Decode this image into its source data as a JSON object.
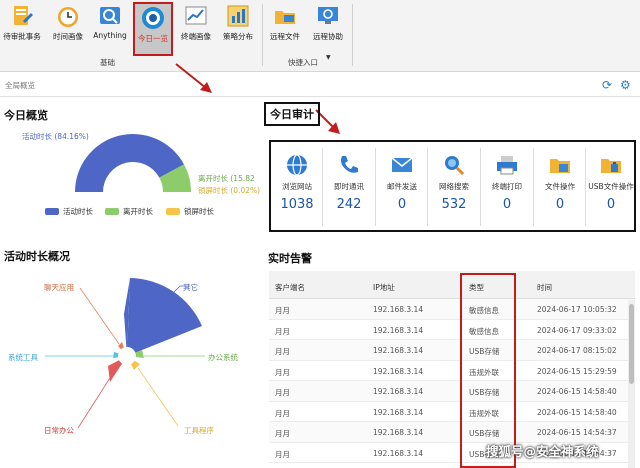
{
  "ribbon": {
    "buttons": [
      {
        "label": "待审批事务",
        "icon": "approval-doc-icon"
      },
      {
        "label": "时间画像",
        "icon": "clock-icon"
      },
      {
        "label": "Anything",
        "icon": "search-all-icon"
      },
      {
        "label": "今日一览",
        "icon": "eye-icon"
      },
      {
        "label": "终端画像",
        "icon": "line-chart-icon"
      },
      {
        "label": "策略分布",
        "icon": "bar-chart-icon"
      },
      {
        "label": "远程文件",
        "icon": "folder-monitor-icon"
      },
      {
        "label": "远程协助",
        "icon": "remote-assist-icon"
      }
    ],
    "groups": {
      "basic": "基础",
      "quick": "快捷入口"
    },
    "active_color": "#c21d1d"
  },
  "breadcrumb": {
    "text": "全局概览",
    "refresh_icon": "refresh-icon",
    "settings_icon": "gear-icon"
  },
  "overview": {
    "title": "今日概览",
    "labels": {
      "active": "活动时长 (84.16%)",
      "away": "离开时长 (15.82",
      "lock": "锁屏时长 (0.02%)"
    },
    "legend": [
      "活动时长",
      "离开时长",
      "锁屏时长"
    ],
    "colors": {
      "active": "#4e67c6",
      "away": "#8dcc6a",
      "lock": "#f5c54a"
    }
  },
  "chart_data": {
    "type": "pie",
    "categories": [
      "活动时长",
      "离开时长",
      "锁屏时长"
    ],
    "values": [
      84.16,
      15.82,
      0.02
    ]
  },
  "activity": {
    "title": "活动时长概况",
    "labels": [
      "其它",
      "办公系统",
      "工具程序",
      "日常办公",
      "系统工具",
      "聊天应用"
    ]
  },
  "audit": {
    "title": "今日审计",
    "cards": [
      {
        "label": "浏览网站",
        "value": "1038",
        "icon": "globe-icon"
      },
      {
        "label": "即时通讯",
        "value": "242",
        "icon": "phone-icon"
      },
      {
        "label": "邮件发送",
        "value": "0",
        "icon": "mail-icon"
      },
      {
        "label": "网络搜索",
        "value": "532",
        "icon": "search-globe-icon"
      },
      {
        "label": "终端打印",
        "value": "0",
        "icon": "printer-icon"
      },
      {
        "label": "文件操作",
        "value": "0",
        "icon": "file-folder-icon"
      },
      {
        "label": "USB文件操作",
        "value": "0",
        "icon": "usb-folder-icon"
      }
    ]
  },
  "alerts": {
    "title": "实时告警",
    "columns": [
      "客户端名",
      "IP地址",
      "类型",
      "时间"
    ],
    "rows": [
      [
        "月月",
        "192.168.3.14",
        "敏感信息",
        "2024-06-17 10:05:32"
      ],
      [
        "月月",
        "192.168.3.14",
        "敏感信息",
        "2024-06-17 09:33:02"
      ],
      [
        "月月",
        "192.168.3.14",
        "USB存储",
        "2024-06-17 08:15:02"
      ],
      [
        "月月",
        "192.168.3.14",
        "违规外联",
        "2024-06-15 15:29:59"
      ],
      [
        "月月",
        "192.168.3.14",
        "USB存储",
        "2024-06-15 14:58:40"
      ],
      [
        "月月",
        "192.168.3.14",
        "违规外联",
        "2024-06-15 14:58:40"
      ],
      [
        "月月",
        "192.168.3.14",
        "USB存储",
        "2024-06-15 14:54:37"
      ],
      [
        "月月",
        "192.168.3.14",
        "USB存储",
        "2024-06-15 14:54:37"
      ]
    ]
  },
  "watermark": "搜狐号@安全神系统"
}
